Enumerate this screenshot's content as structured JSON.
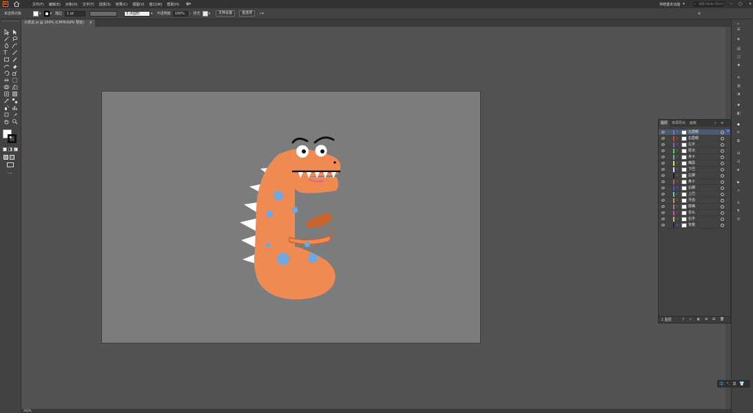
{
  "menubar": {
    "app_logo": "Ai",
    "items": [
      "文件(F)",
      "编辑(E)",
      "对象(O)",
      "文字(T)",
      "选择(S)",
      "效果(C)",
      "视图(V)",
      "窗口(W)",
      "帮助(H)"
    ],
    "workspace": "传统基本功能",
    "search_placeholder": "搜索 Adobe Stock"
  },
  "controlbar": {
    "selection_label": "未选择对象",
    "stroke_label": "描边",
    "stroke_value": "1 pt",
    "brush_label": "3 点圆形",
    "opacity_label": "不透明度",
    "opacity_value": "100%",
    "style_label": "样式",
    "doc_setup_button": "文档设置",
    "prefs_button": "首选项"
  },
  "document": {
    "tab_title": "小恐龙.ai @ 200% (CMYK/GPU 预览)",
    "close": "×"
  },
  "status": {
    "zoom": "200%"
  },
  "layers_panel": {
    "tabs": [
      "图层",
      "资源导出",
      "画板"
    ],
    "footer_label": "1 图层",
    "layers": [
      {
        "name": "左眉眼",
        "color": "#4f7fd8"
      },
      {
        "name": "右眉眼",
        "color": "#e04343"
      },
      {
        "name": "左手",
        "color": "#a14fd8"
      },
      {
        "name": "斑点",
        "color": "#4fd84f"
      },
      {
        "name": "身子",
        "color": "#4fb9d8"
      },
      {
        "name": "嘴唇",
        "color": "#e0e04f"
      },
      {
        "name": "下巴",
        "color": "#e0e0e0"
      },
      {
        "name": "左脚",
        "color": "#1a1a1a"
      },
      {
        "name": "鼻子",
        "color": "#d84f4f"
      },
      {
        "name": "右脚",
        "color": "#4f4fd8"
      },
      {
        "name": "上巴",
        "color": "#4fd8b0"
      },
      {
        "name": "牙齿",
        "color": "#d88f4f"
      },
      {
        "name": "鼓嘴",
        "color": "#8a8a8a"
      },
      {
        "name": "舌头",
        "color": "#d84fa8"
      },
      {
        "name": "右手",
        "color": "#a8d84f"
      },
      {
        "name": "背景",
        "color": "#1a1a8a"
      }
    ]
  },
  "ime": {
    "label": "中",
    "punct": "°,",
    "half": "半"
  },
  "colors": {
    "dino_body": "#f08a53",
    "dino_arm": "#c8652e",
    "spots": "#6fa8e0",
    "spikes": "#ffffff"
  }
}
